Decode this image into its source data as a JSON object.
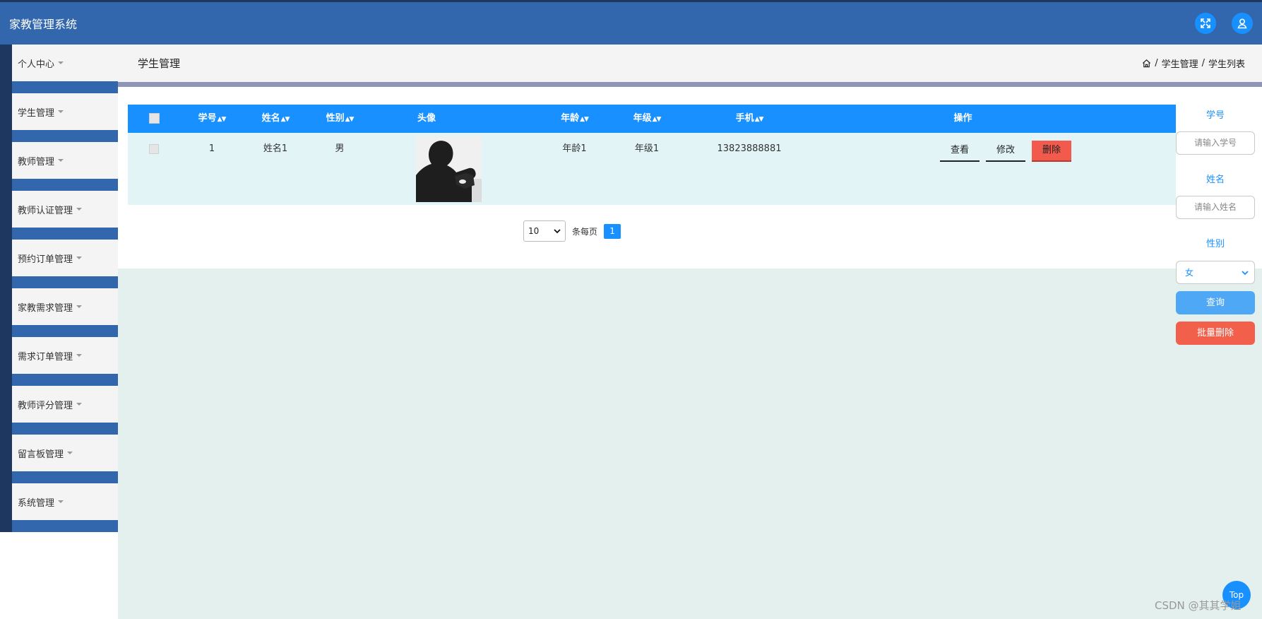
{
  "header": {
    "app_title": "家教管理系统",
    "icons": [
      "fullscreen-icon",
      "user-icon"
    ]
  },
  "sidebar": {
    "items": [
      {
        "label": "个人中心"
      },
      {
        "label": "学生管理"
      },
      {
        "label": "教师管理"
      },
      {
        "label": "教师认证管理"
      },
      {
        "label": "预约订单管理"
      },
      {
        "label": "家教需求管理"
      },
      {
        "label": "需求订单管理"
      },
      {
        "label": "教师评分管理"
      },
      {
        "label": "留言板管理"
      },
      {
        "label": "系统管理"
      }
    ]
  },
  "page": {
    "title": "学生管理",
    "breadcrumb": {
      "level1": "学生管理",
      "sep": "/",
      "level2": "学生列表"
    }
  },
  "table": {
    "columns": {
      "id": "学号",
      "name": "姓名",
      "gender": "性别",
      "avatar": "头像",
      "age": "年龄",
      "grade": "年级",
      "phone": "手机",
      "ops": "操作"
    },
    "rows": [
      {
        "id": "1",
        "name": "姓名1",
        "gender": "男",
        "age": "年龄1",
        "grade": "年级1",
        "phone": "13823888881"
      }
    ],
    "actions": {
      "view": "查看",
      "edit": "修改",
      "delete": "删除"
    }
  },
  "pager": {
    "page_size": "10",
    "per_page_label": "条每页",
    "current_page": "1"
  },
  "filters": {
    "id_label": "学号",
    "id_placeholder": "请输入学号",
    "name_label": "姓名",
    "name_placeholder": "请输入姓名",
    "gender_label": "性别",
    "gender_value": "女",
    "query_button": "查询",
    "batch_delete_button": "批量删除"
  },
  "misc": {
    "top_button": "Top",
    "watermark": "CSDN @其其学姐"
  },
  "colors": {
    "header": "#3267ad",
    "primary": "#1890ff",
    "danger": "#f15a4d",
    "sidebar_dark": "#1e3760",
    "content_bg": "#e4f0ed"
  }
}
